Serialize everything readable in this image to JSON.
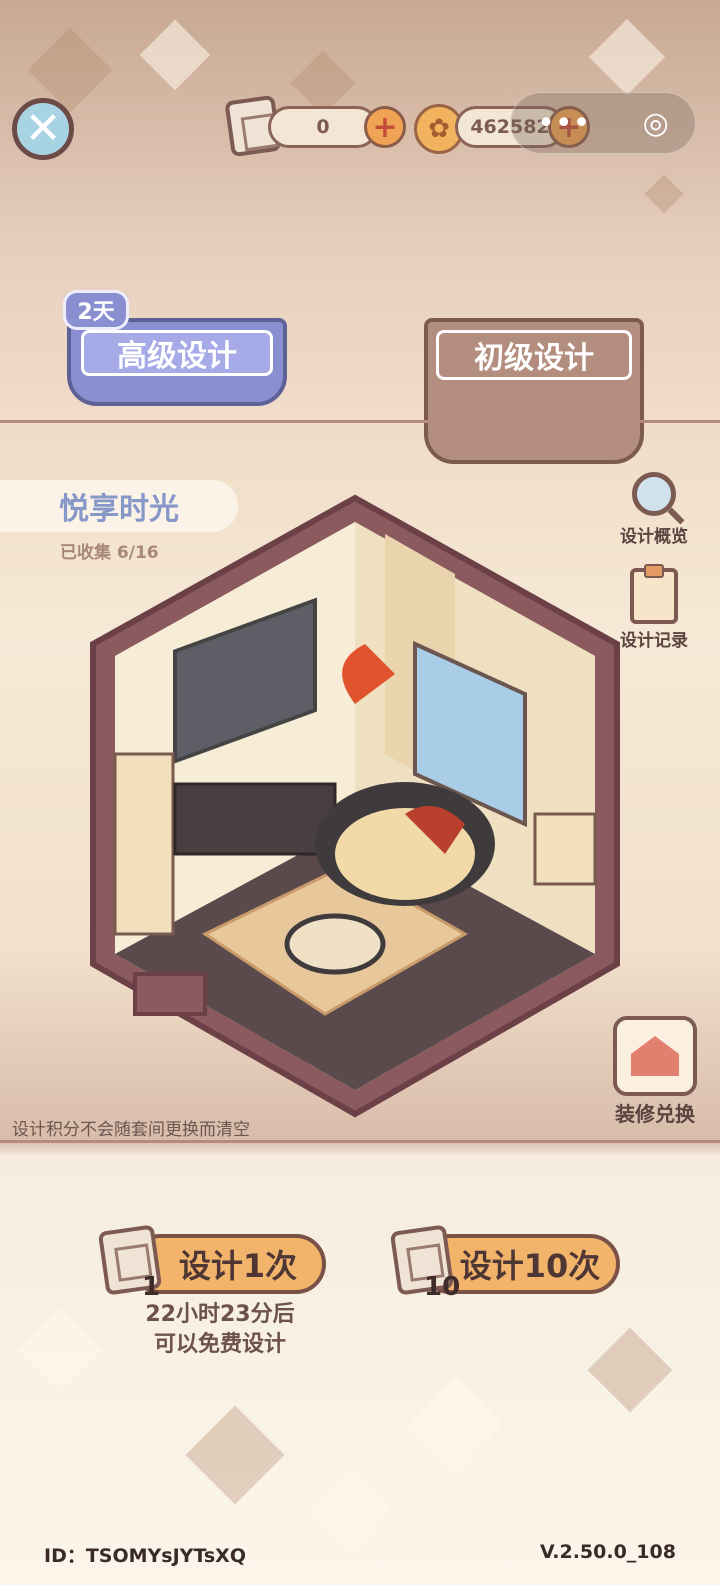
{
  "topbar": {
    "blueprint_count": "0",
    "coin_count": "462582",
    "capsule_more": "•••",
    "capsule_target": "◎"
  },
  "tabs": {
    "advanced": {
      "label": "高级设计",
      "badge": "2天"
    },
    "basic": {
      "label": "初级设计"
    }
  },
  "theme": {
    "name": "悦享时光",
    "collected": "已收集 6/16"
  },
  "side_tools": {
    "overview": "设计概览",
    "records": "设计记录",
    "exchange": "装修兑换"
  },
  "hint": "设计积分不会随套间更换而清空",
  "design_actions": {
    "once": {
      "label": "设计1次",
      "cost": "1"
    },
    "ten": {
      "label": "设计10次",
      "cost": "10"
    },
    "free_timer_line1": "22小时23分后",
    "free_timer_line2": "可以免费设计"
  },
  "footer": {
    "id": "ID：TSOMYsJYTsXQ",
    "version": "V.2.50.0_108"
  },
  "colors": {
    "accent_orange": "#f2b36b",
    "advanced_tab": "#8a8fd1",
    "basic_tab": "#b38d7d",
    "close_button": "#a8d3e3"
  }
}
